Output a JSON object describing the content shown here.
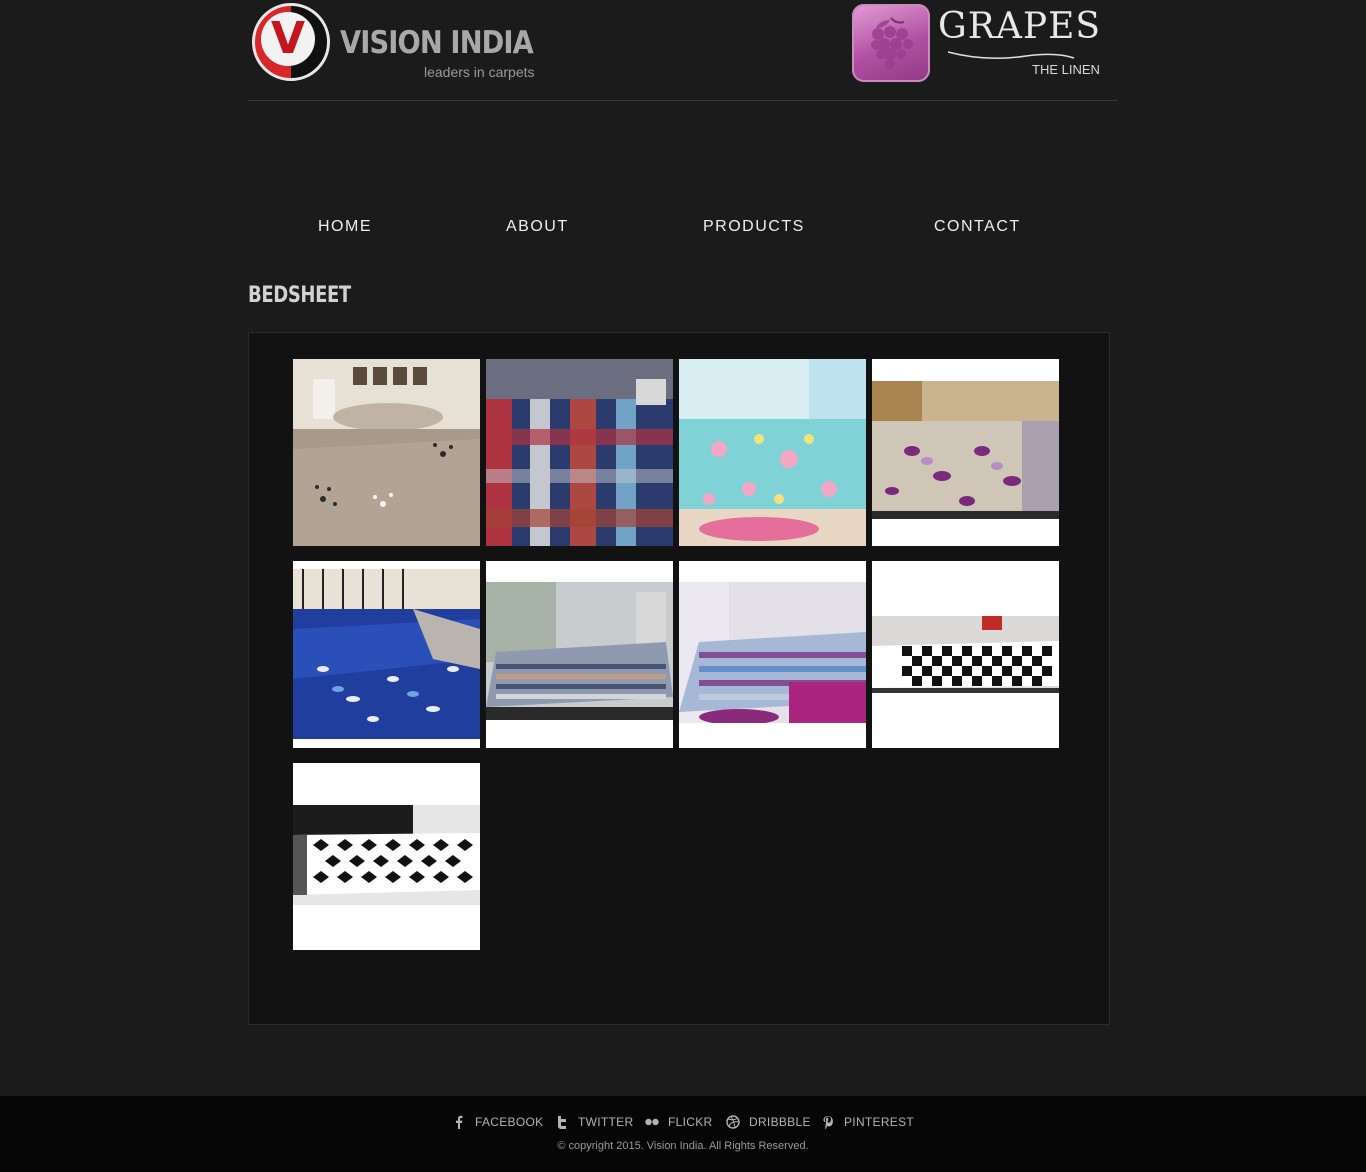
{
  "header": {
    "brand_name": "VISION INDIA",
    "brand_tagline": "leaders in carpets",
    "partner_name": "GRAPES",
    "partner_tagline": "THE LINEN"
  },
  "nav": {
    "items": [
      {
        "label": "HOME"
      },
      {
        "label": "ABOUT"
      },
      {
        "label": "PRODUCTS"
      },
      {
        "label": "CONTACT"
      }
    ]
  },
  "page": {
    "title": "BEDSHEET"
  },
  "gallery": [
    {
      "alt": "beige bedsheet with black floral pattern"
    },
    {
      "alt": "red and blue plaid bedsheet"
    },
    {
      "alt": "turquoise bedsheet with cartoon print"
    },
    {
      "alt": "beige bedsheet with purple leaves"
    },
    {
      "alt": "royal blue bedsheet with white leaves"
    },
    {
      "alt": "grey and blue striped bedsheet"
    },
    {
      "alt": "purple and blue striped bedsheet"
    },
    {
      "alt": "black and white checkered bedsheet"
    },
    {
      "alt": "black and white houndstooth bedsheet"
    }
  ],
  "footer": {
    "social": [
      {
        "label": "FACEBOOK",
        "icon": "facebook-icon"
      },
      {
        "label": "TWITTER",
        "icon": "twitter-icon"
      },
      {
        "label": "FLICKR",
        "icon": "flickr-icon"
      },
      {
        "label": "DRIBBBLE",
        "icon": "dribbble-icon"
      },
      {
        "label": "PINTEREST",
        "icon": "pinterest-icon"
      }
    ],
    "copyright": "© copyright 2015. Vision India. All Rights Reserved."
  }
}
